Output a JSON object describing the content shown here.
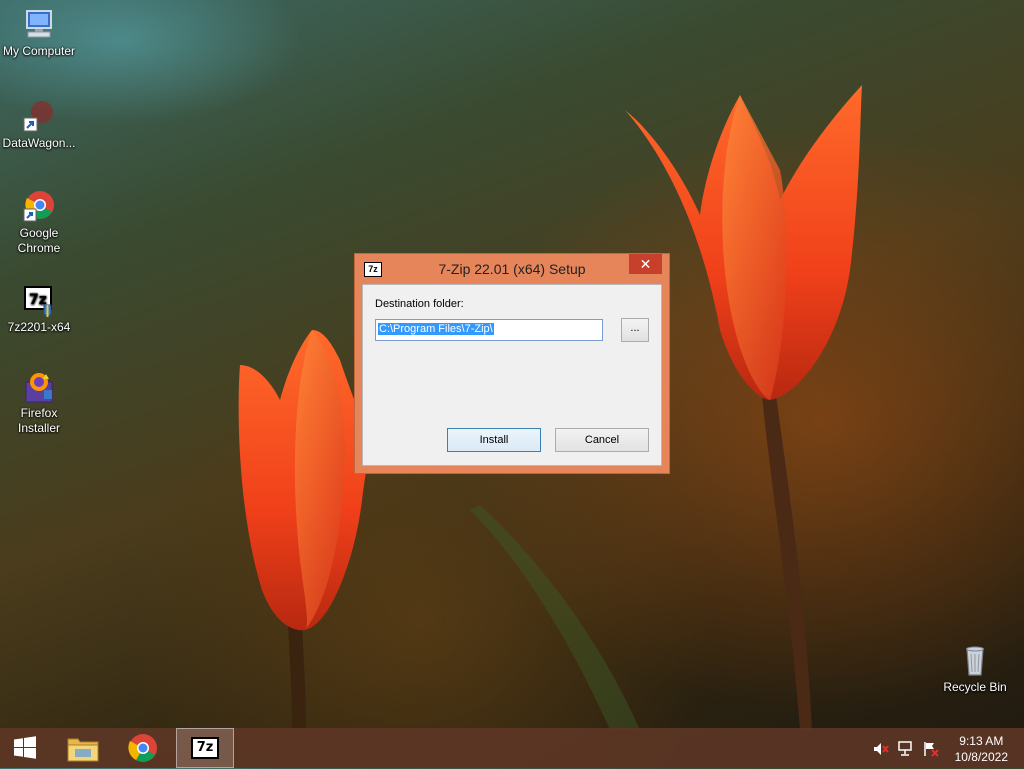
{
  "desktop": {
    "icons": [
      {
        "label": "My Computer",
        "icon": "computer-icon"
      },
      {
        "label": "DataWagon...",
        "icon": "shortcut-icon"
      },
      {
        "label": "Google Chrome",
        "icon": "chrome-icon"
      },
      {
        "label": "7z2201-x64",
        "icon": "7zip-installer-icon"
      },
      {
        "label": "Firefox Installer",
        "icon": "firefox-installer-icon"
      },
      {
        "label": "Recycle Bin",
        "icon": "recycle-bin-icon"
      }
    ]
  },
  "dialog": {
    "title": "7-Zip 22.01 (x64) Setup",
    "app_icon_text": "7z",
    "close_symbol": "✕",
    "destination_label": "Destination folder:",
    "destination_value": "C:\\Program Files\\7-Zip\\",
    "browse_label": "...",
    "install_label": "Install",
    "cancel_label": "Cancel"
  },
  "taskbar": {
    "items": [
      "start-button",
      "file-explorer",
      "google-chrome",
      "7-zip-setup"
    ],
    "active_item": "7-zip-setup",
    "seven_zip_text": "7z",
    "tray": [
      "volume-muted-icon",
      "network-icon",
      "action-center-flag-icon"
    ],
    "time": "9:13 AM",
    "date": "10/8/2022"
  },
  "colors": {
    "window_frame": "#e6855a",
    "close_button": "#c7402c",
    "taskbar": "#5f3726",
    "selection": "#3399ff"
  }
}
